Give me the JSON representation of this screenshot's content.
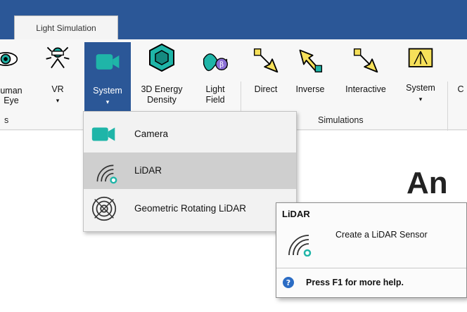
{
  "tab": {
    "label": "Light Simulation"
  },
  "ribbon": {
    "buttons": {
      "human_eye": {
        "line1": "uman",
        "line2": "Eye"
      },
      "vr": {
        "label": "VR",
        "arrow": "▾"
      },
      "system_sensor": {
        "label": "System",
        "arrow": "▾"
      },
      "energy_density": {
        "line1": "3D Energy",
        "line2": "Density"
      },
      "light_field": {
        "line1": "Light",
        "line2": "Field"
      },
      "direct": {
        "label": "Direct"
      },
      "inverse": {
        "label": "Inverse"
      },
      "interactive": {
        "label": "Interactive"
      },
      "system_sim": {
        "label": "System",
        "arrow": "▾"
      },
      "cut": {
        "label": "C"
      }
    },
    "groups": {
      "sensors_fragment": "s",
      "simulations": "Simulations"
    }
  },
  "dropdown": {
    "items": [
      {
        "label": "Camera"
      },
      {
        "label": "LiDAR"
      },
      {
        "label": "Geometric Rotating LiDAR"
      }
    ]
  },
  "tooltip": {
    "title": "LiDAR",
    "description": "Create a LiDAR Sensor",
    "help": "Press F1 for more help."
  },
  "watermark": "An",
  "colors": {
    "accent": "#2b5797",
    "camera_teal": "#1fb5a8",
    "arrow_yellow": "#f6e05a"
  }
}
